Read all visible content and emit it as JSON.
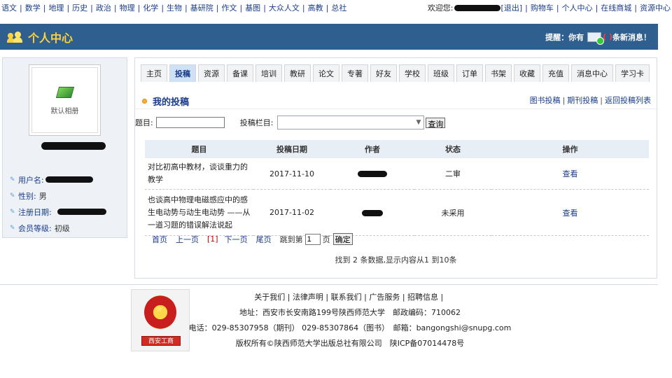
{
  "topbar": {
    "subjects": [
      "语文",
      "数学",
      "地理",
      "历史",
      "政治",
      "物理",
      "化学",
      "生物",
      "基研院",
      "作文",
      "基图",
      "大众人文",
      "高教",
      "总社"
    ],
    "welcome": "欢迎您:",
    "logout": "[退出]",
    "links": [
      "购物车",
      "个人中心",
      "在线商城",
      "资源中心"
    ]
  },
  "header": {
    "title": "个人中心",
    "notice_prefix": "提醒：你有",
    "notice_count": "( )",
    "notice_suffix": "条新消息！"
  },
  "sidebar": {
    "album_label": "默认相册",
    "fields": [
      {
        "label": "用户名:",
        "value": ""
      },
      {
        "label": "性别:",
        "value": "男"
      },
      {
        "label": "注册日期:",
        "value": ""
      },
      {
        "label": "会员等级:",
        "value": "初级"
      }
    ]
  },
  "tabs": [
    "主页",
    "投稿",
    "资源",
    "备课",
    "培训",
    "教研",
    "论文",
    "专著",
    "好友",
    "学校",
    "班级",
    "订单",
    "书架",
    "收藏",
    "充值",
    "消息中心",
    "学习卡"
  ],
  "active_tab": "投稿",
  "section": {
    "title": "我的投稿",
    "links": [
      "图书投稿",
      "期刊投稿",
      "返回投稿列表"
    ]
  },
  "search": {
    "title_label": "题目:",
    "title_value": "",
    "column_label": "投稿栏目:",
    "column_value": "",
    "query_button": "查询"
  },
  "table": {
    "headers": [
      "题目",
      "投稿日期",
      "作者",
      "状态",
      "操作"
    ],
    "rows": [
      {
        "title": "对比初高中教材，谈谈重力的教学",
        "date": "2017-11-10",
        "status": "二审",
        "action": "查看"
      },
      {
        "title": "也谈高中物理电磁感应中的感生电动势与动生电动势 ——从一道习题的错误解法说起",
        "date": "2017-11-02",
        "status": "未采用",
        "action": "查看"
      }
    ]
  },
  "pager": {
    "first": "首页",
    "prev": "上一页",
    "current": "[1]",
    "next": "下一页",
    "last": "尾页",
    "goto_prefix": "跳到第",
    "goto_value": "1",
    "goto_suffix": "页",
    "confirm": "确定",
    "summary": "找到 2 条数据,显示内容从1 到10条"
  },
  "footer": {
    "links": [
      "关于我们",
      "法律声明",
      "联系我们",
      "广告服务",
      "招聘信息"
    ],
    "address": "地址：西安市长安南路199号陕西师范大学　邮政编码：710062",
    "phone": "电话：029-85307958（期刊）  029-85307864（图书）　邮箱：bangongshi@snupg.com",
    "copyright": "版权所有©陕西师范大学出版总社有限公司　陕ICP备07014478号",
    "badge_text": "西安工商"
  }
}
